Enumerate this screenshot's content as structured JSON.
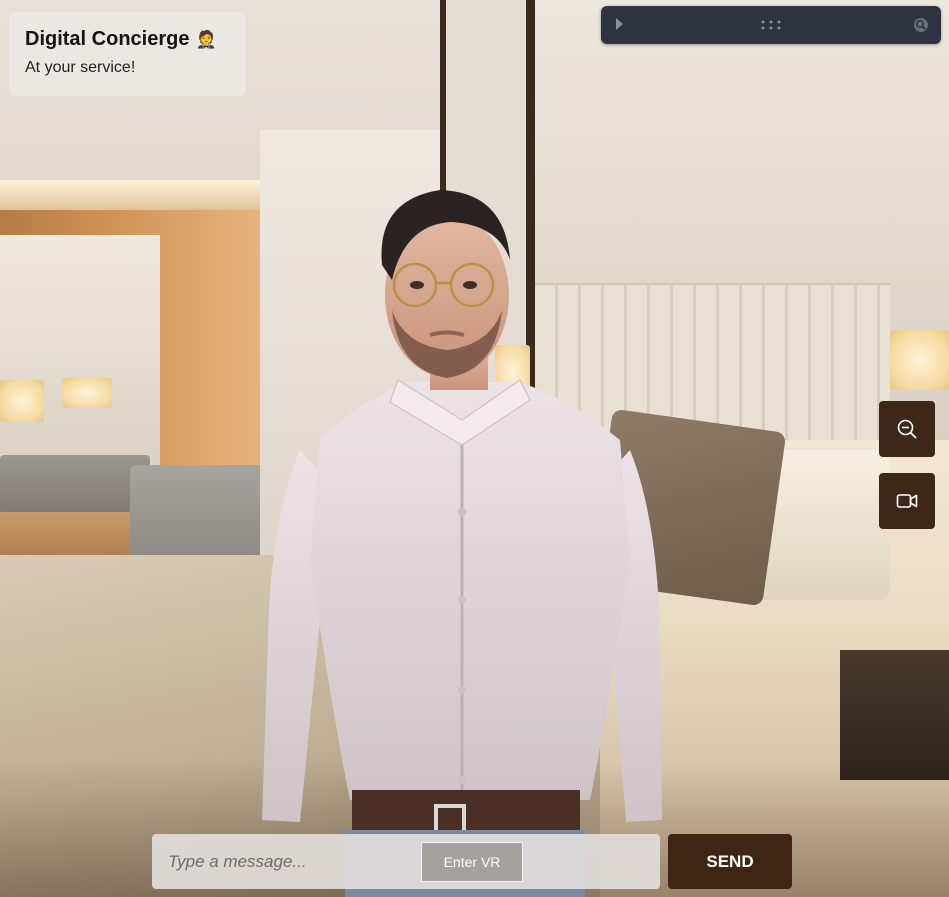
{
  "header": {
    "title": "Digital Concierge",
    "emoji": "🤵",
    "subtitle": "At your service!"
  },
  "toolbar": {
    "icons": [
      "play-icon",
      "drag-handle-icon",
      "zoom-icon"
    ]
  },
  "side_controls": {
    "icons": [
      "zoom-out-icon",
      "video-camera-icon"
    ]
  },
  "chat": {
    "placeholder": "Type a message...",
    "vr_label": "Enter VR",
    "send_label": "SEND"
  },
  "colors": {
    "accent": "#3e2514",
    "toolbar_bg": "#2e3342",
    "card_bg": "#ece8e4"
  }
}
